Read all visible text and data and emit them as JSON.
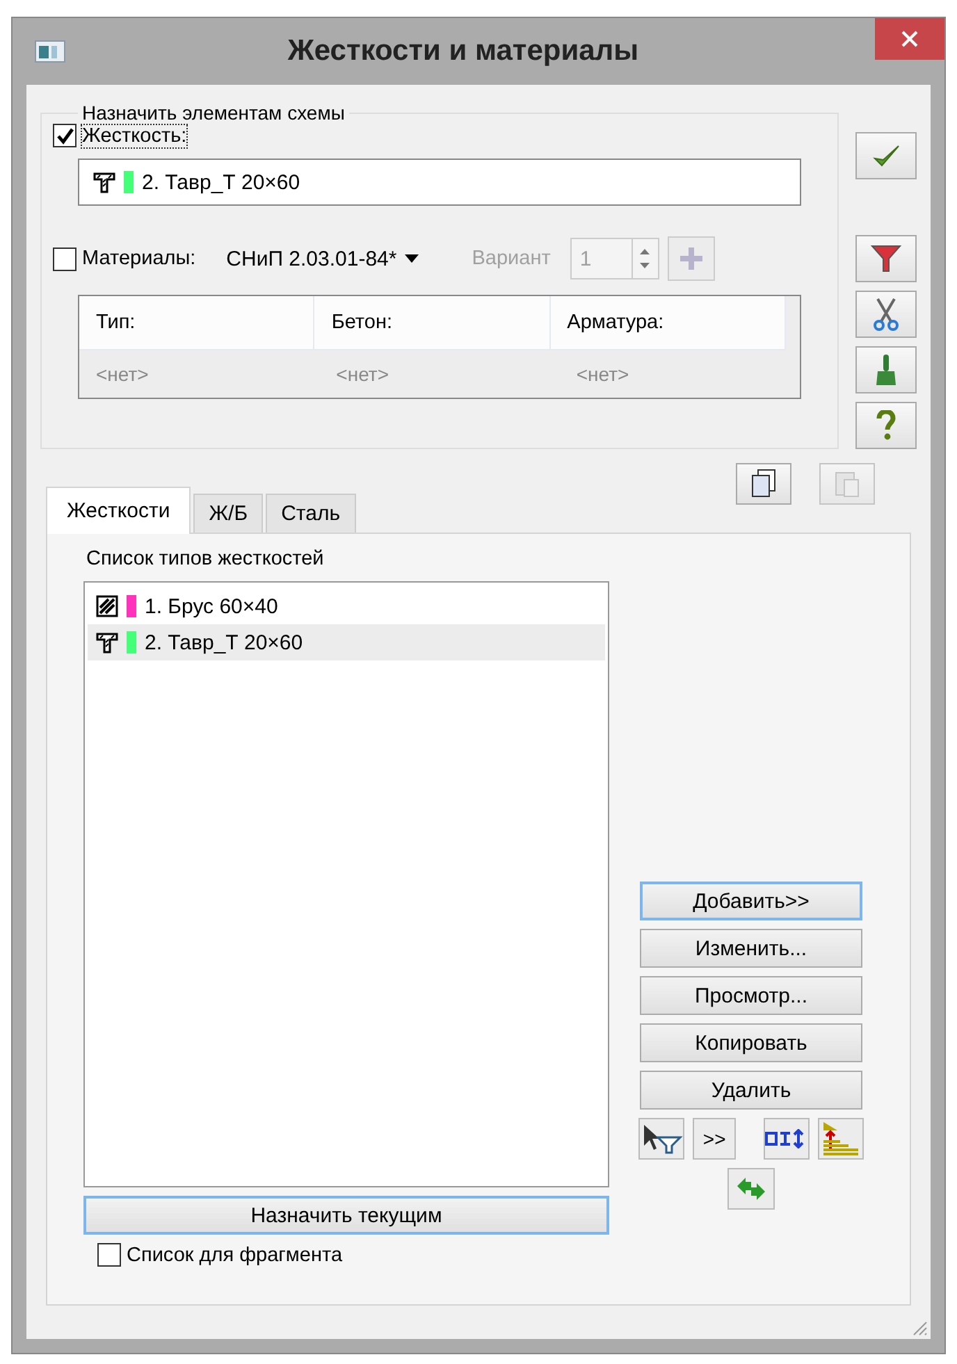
{
  "window": {
    "title": "Жесткости и материалы"
  },
  "assign": {
    "legend": "Назначить элементам схемы",
    "stiffness": {
      "label": "Жесткость:",
      "checked": true
    },
    "current": {
      "name": "2. Тавр_Т 20×60",
      "kind": "tee",
      "color": "#44ff77"
    },
    "materials": {
      "label": "Материалы:",
      "checked": false
    },
    "norm": "СНиП 2.03.01-84*",
    "variant": {
      "label": "Вариант",
      "value": "1",
      "disabled": true
    },
    "table": {
      "columns": [
        "Тип:",
        "Бетон:",
        "Арматура:"
      ],
      "rows": [
        [
          "<нет>",
          "<нет>",
          "<нет>"
        ]
      ]
    }
  },
  "tabs": [
    {
      "label": "Жесткости",
      "selected": true
    },
    {
      "label": "Ж/Б",
      "selected": false
    },
    {
      "label": "Сталь",
      "selected": false
    }
  ],
  "list": {
    "title": "Список типов жесткостей",
    "items": [
      {
        "name": "1. Брус 60×40",
        "kind": "hatched",
        "color": "#ff33bb",
        "selected": false
      },
      {
        "name": "2. Тавр_Т 20×60",
        "kind": "tee",
        "color": "#44ff77",
        "selected": true
      }
    ]
  },
  "buttons": [
    {
      "label": "Добавить>>",
      "focused": true
    },
    {
      "label": "Изменить...",
      "focused": false
    },
    {
      "label": "Просмотр...",
      "focused": false
    },
    {
      "label": "Копировать",
      "focused": false
    },
    {
      "label": "Удалить",
      "focused": false
    }
  ],
  "more_button": ">>",
  "assign_button": "Назначить текущим",
  "fragment": {
    "label": "Список для фрагмента",
    "checked": false
  }
}
